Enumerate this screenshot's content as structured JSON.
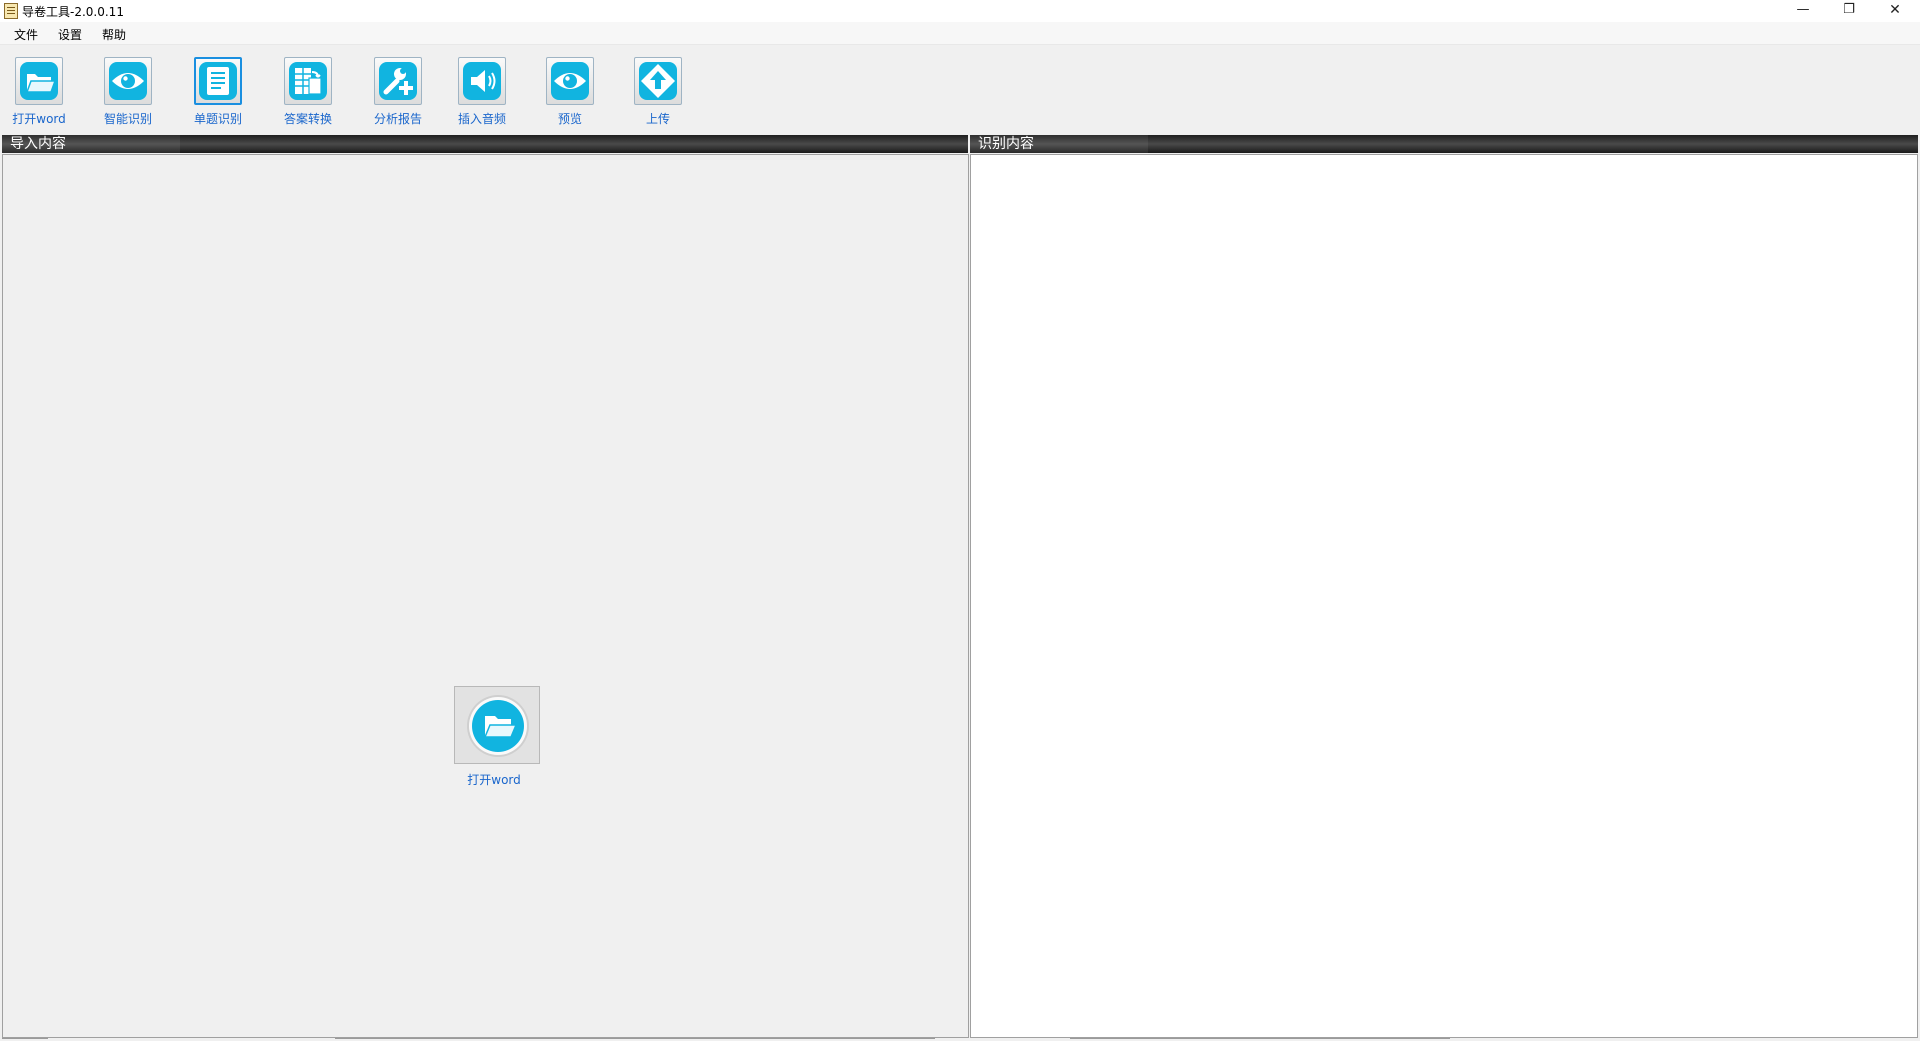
{
  "window": {
    "title": "导卷工具-2.0.0.11",
    "controls": {
      "minimize": "—",
      "maximize": "❐",
      "close": "✕"
    }
  },
  "menu": [
    "文件",
    "设置",
    "帮助"
  ],
  "toolbar": [
    {
      "label": "打开word",
      "icon": "folder-icon"
    },
    {
      "label": "智能识别",
      "icon": "eye-icon"
    },
    {
      "label": "单题识别",
      "icon": "document-icon",
      "active": true
    },
    {
      "label": "答案转换",
      "icon": "grid-convert-icon"
    },
    {
      "label": "分析报告",
      "icon": "wrench-plus-icon"
    },
    {
      "label": "插入音频",
      "icon": "speaker-icon"
    },
    {
      "label": "预览",
      "icon": "eye-icon"
    },
    {
      "label": "上传",
      "icon": "upload-arrow-icon"
    }
  ],
  "panels": {
    "left": {
      "title": "导入内容",
      "center_button_label": "打开word"
    },
    "right": {
      "title": "识别内容"
    }
  },
  "colors": {
    "accent_icon": "#11b4e0",
    "label_blue": "#1a66cc",
    "panel_header_dark": "#2a2a2a"
  }
}
